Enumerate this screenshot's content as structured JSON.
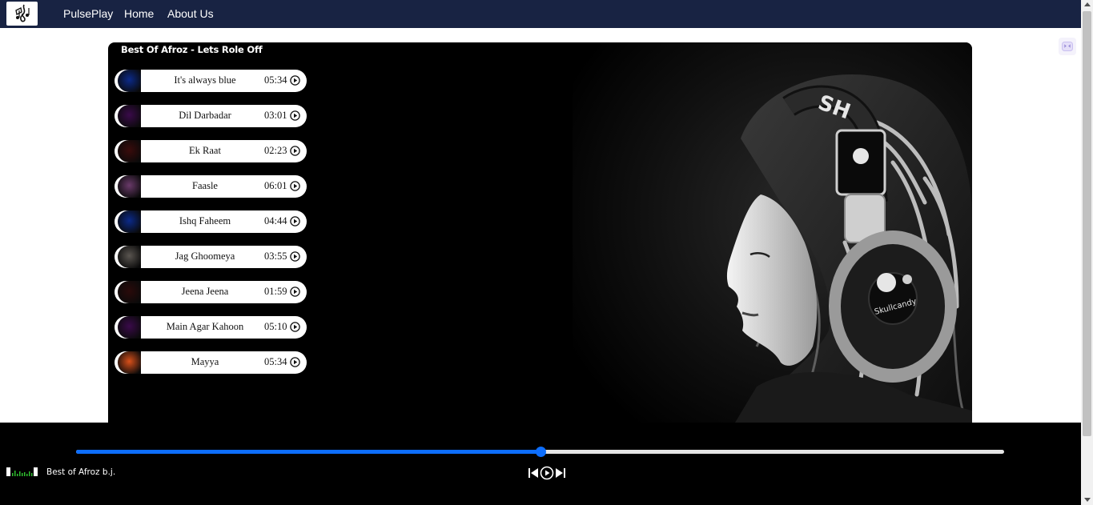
{
  "nav": {
    "brand": "PulsePlay",
    "home": "Home",
    "about": "About Us",
    "logo_icon": "music-note-logo"
  },
  "playlist": {
    "title": "Best Of Afroz - Lets Role Off",
    "songs": [
      {
        "name": "It's always blue",
        "duration": "05:34",
        "thumb_color": "#0b2a8a"
      },
      {
        "name": "Dil Darbadar",
        "duration": "03:01",
        "thumb_color": "#3a0a4a"
      },
      {
        "name": "Ek Raat",
        "duration": "02:23",
        "thumb_color": "#3a0b0b"
      },
      {
        "name": "Faasle",
        "duration": "06:01",
        "thumb_color": "#6a3a6a"
      },
      {
        "name": "Ishq Faheem",
        "duration": "04:44",
        "thumb_color": "#0b2a8a"
      },
      {
        "name": "Jag Ghoomeya",
        "duration": "03:55",
        "thumb_color": "#5a5550"
      },
      {
        "name": "Jeena Jeena",
        "duration": "01:59",
        "thumb_color": "#2a0a0a"
      },
      {
        "name": "Main Agar Kahoon",
        "duration": "05:10",
        "thumb_color": "#3a0a4a"
      },
      {
        "name": "Mayya",
        "duration": "05:34",
        "thumb_color": "#d8501a"
      }
    ]
  },
  "player": {
    "now_playing": "Best of Afroz b.j.",
    "progress": 0.5,
    "accent_color": "#0d6efd"
  },
  "colors": {
    "navbar": "#182343",
    "panel": "#000000"
  }
}
